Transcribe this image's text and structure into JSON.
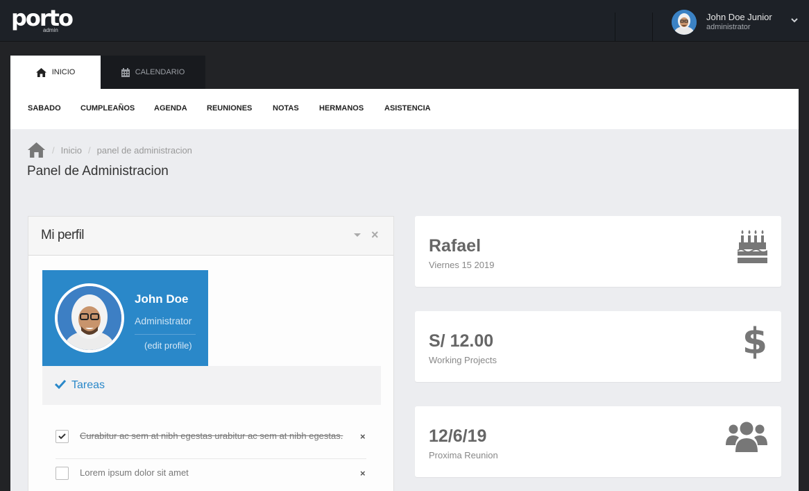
{
  "header": {
    "logo_text": "porto",
    "logo_sub": "admin",
    "user_name": "John Doe Junior",
    "user_role": "administrator"
  },
  "tabs": [
    {
      "label": "INICIO",
      "icon": "home-icon",
      "active": true
    },
    {
      "label": "CALENDARIO",
      "icon": "calendar-icon",
      "active": false
    }
  ],
  "nav": [
    "SABADO",
    "CUMPLEAÑOS",
    "AGENDA",
    "REUNIONES",
    "NOTAS",
    "HERMANOS",
    "ASISTENCIA"
  ],
  "breadcrumb": {
    "home_icon": "home-icon",
    "items": [
      "Inicio",
      "panel de administracion"
    ]
  },
  "page_title": "Panel de Administracion",
  "profile_panel": {
    "title": "Mi perfil",
    "name": "John Doe",
    "role": "Administrator",
    "edit_link": "(edit profile)",
    "tasks_title": "Tareas",
    "tasks": [
      {
        "text": "Curabitur ac sem at nibh egestas urabitur ac sem at nibh egestas.",
        "done": true
      },
      {
        "text": "Lorem ipsum dolor sit amet",
        "done": false
      }
    ]
  },
  "cards": [
    {
      "value": "Rafael",
      "label": "Viernes 15 2019",
      "icon": "cake-icon"
    },
    {
      "value": "S/ 12.00",
      "label": "Working Projects",
      "icon": "dollar-icon"
    },
    {
      "value": "12/6/19",
      "label": "Proxima Reunion",
      "icon": "users-icon"
    }
  ],
  "colors": {
    "accent": "#2a88c9",
    "header_bg": "#1d2127",
    "content_bg": "#ecedf0"
  }
}
